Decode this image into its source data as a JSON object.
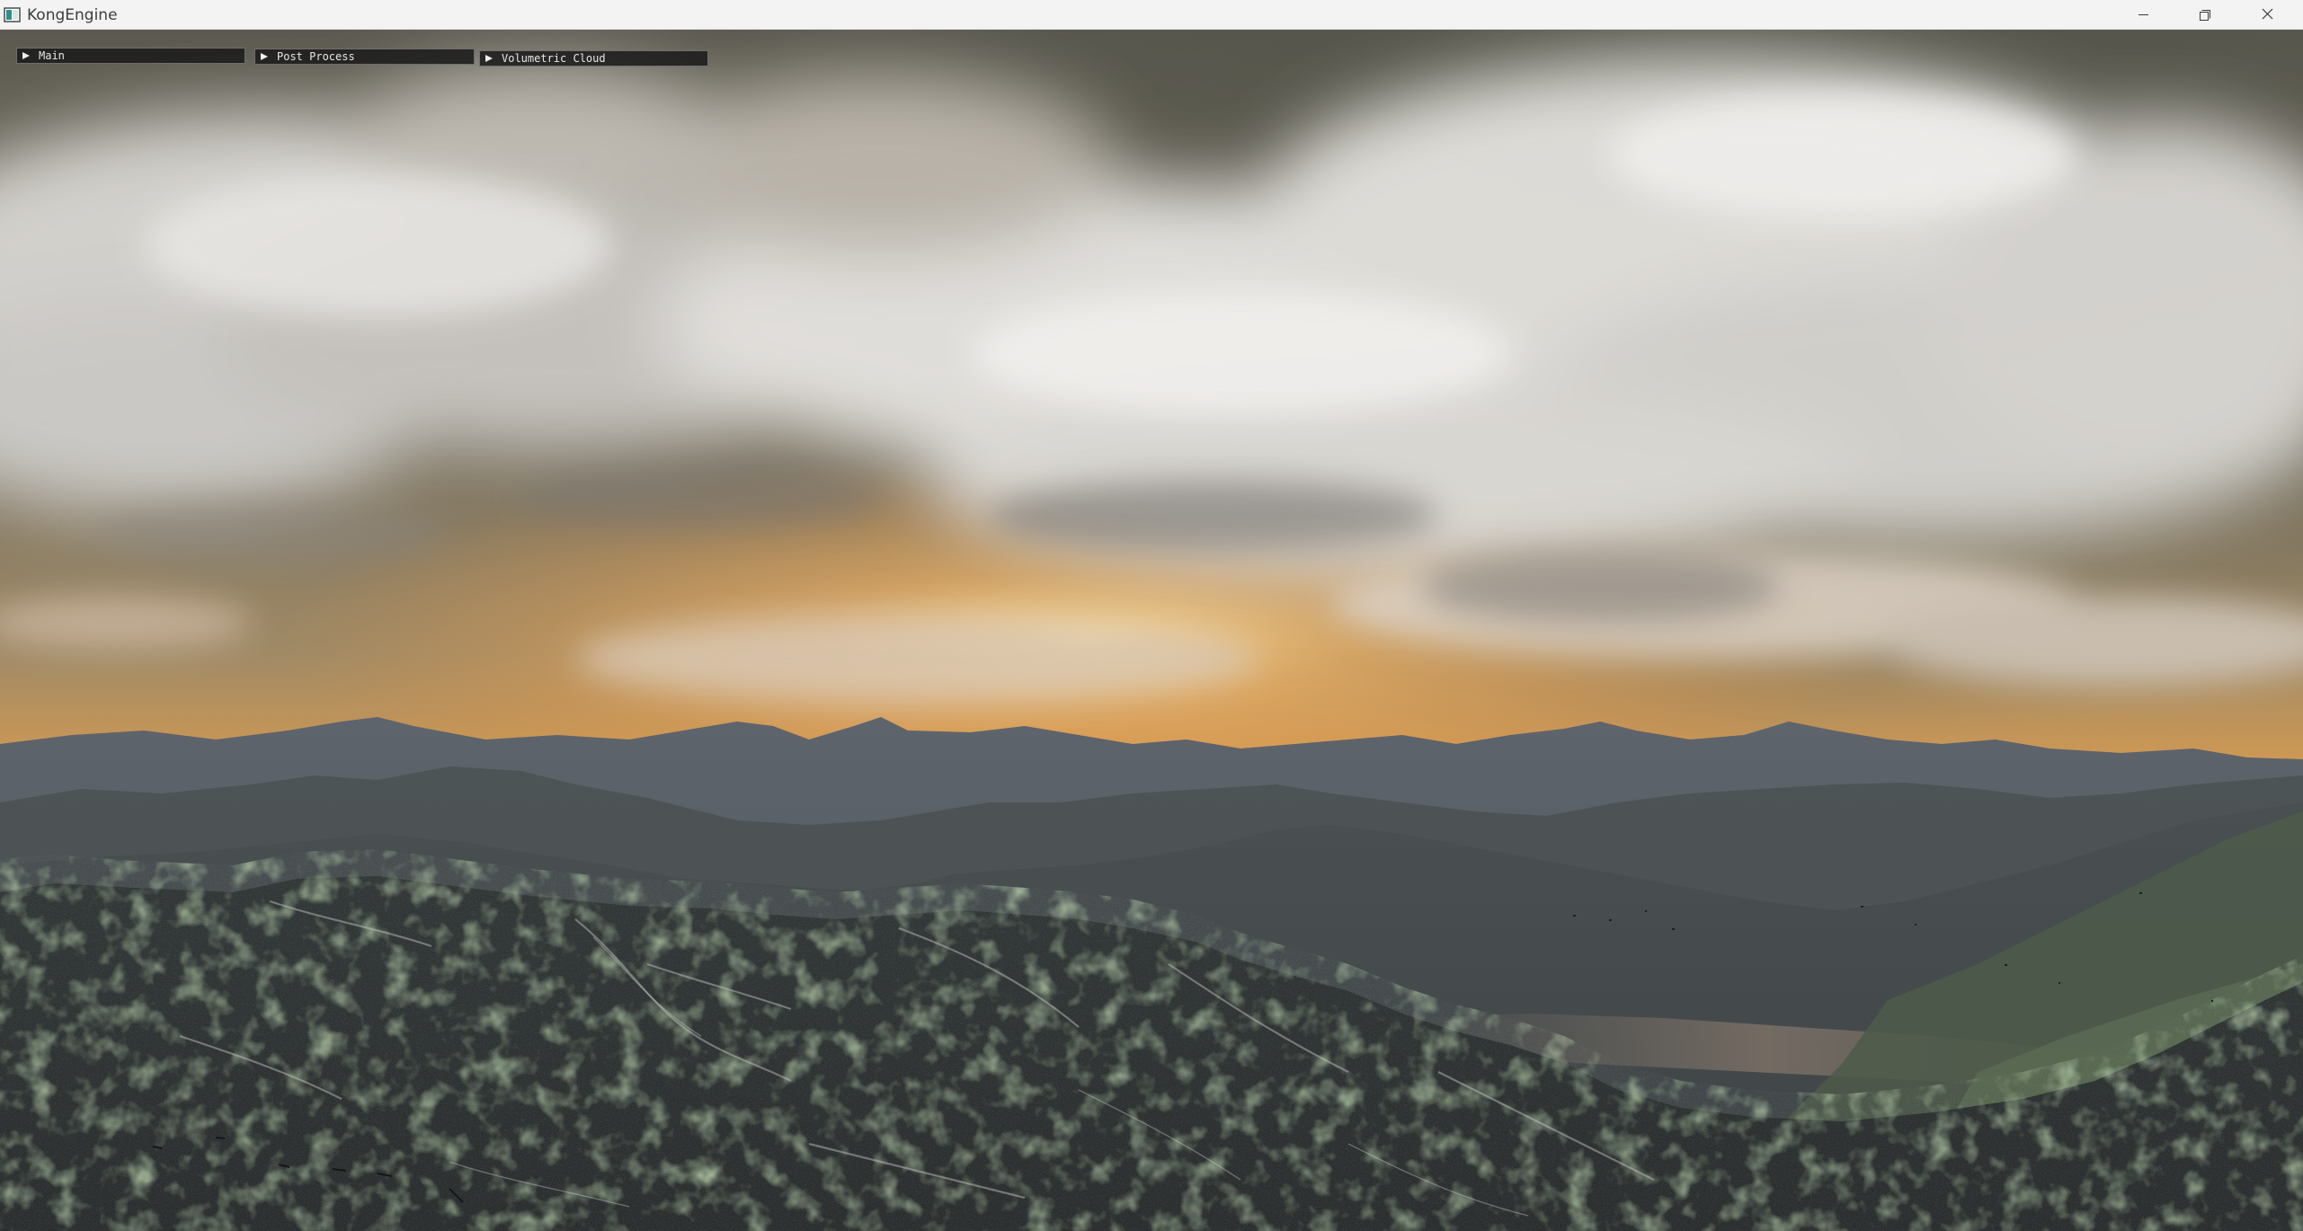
{
  "window": {
    "title": "KongEngine",
    "controls": {
      "minimize_icon": "minimize-icon",
      "maximize_icon": "restore-icon",
      "close_icon": "close-icon"
    }
  },
  "panels": [
    {
      "label": "Main",
      "collapsed": true
    },
    {
      "label": "Post Process",
      "collapsed": true
    },
    {
      "label": "Volumetric Cloud",
      "collapsed": true
    }
  ],
  "colors": {
    "titlebar": "#f3f3f3",
    "sky_top": "#6b6758",
    "sunset_glow": "#f2b25a",
    "horizon_orange": "#e08a3a",
    "cloud": "#e6e4e0",
    "mountain_far": "#5a6068",
    "terrain_dark": "#2e3232",
    "grass": "#6f8a5a",
    "imgui_header_bg": "#1a1a1a",
    "imgui_text": "#e8e8e8"
  }
}
